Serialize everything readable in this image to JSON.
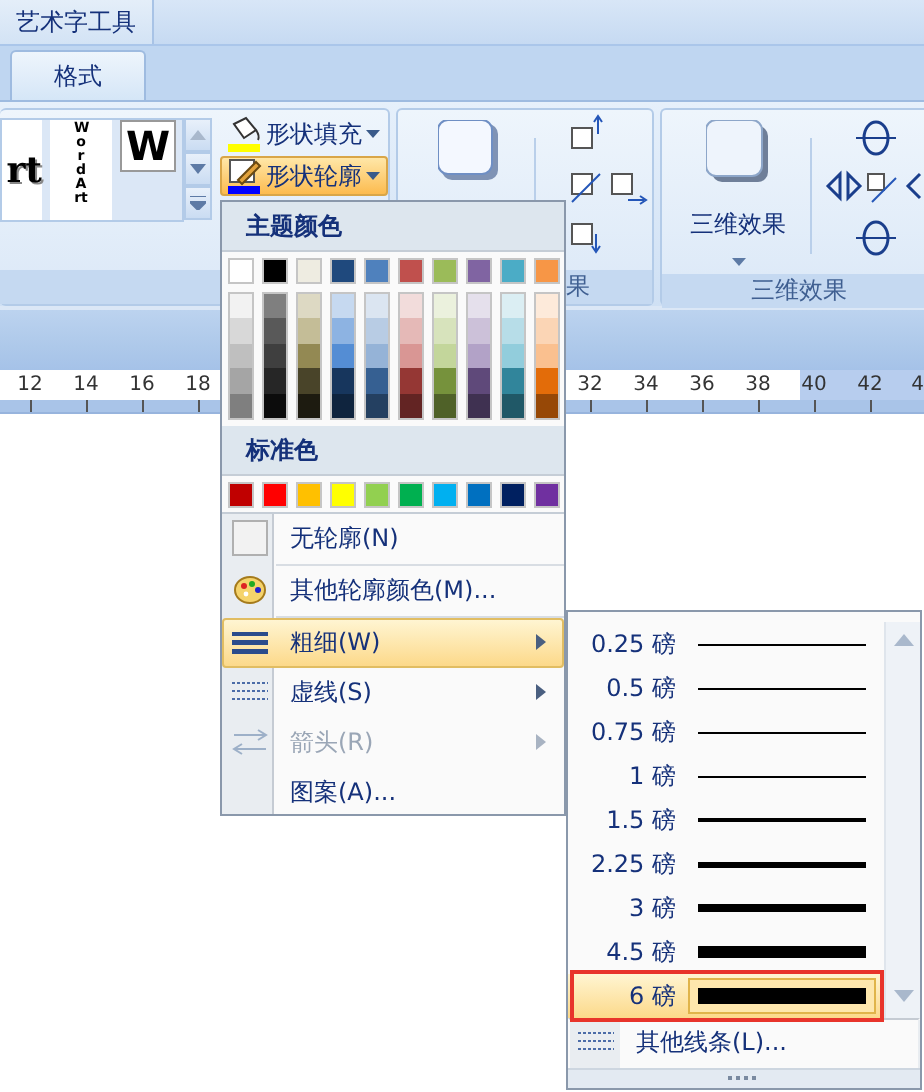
{
  "contextual_tab": {
    "title": "艺术字工具"
  },
  "tabs": [
    {
      "label": "格式",
      "selected": true
    }
  ],
  "ribbon": {
    "wordart_gallery": [
      {
        "text": "rt",
        "kind": "shadow"
      },
      {
        "text": "WordArt",
        "kind": "vertical"
      },
      {
        "text": "W",
        "kind": "block"
      }
    ],
    "shape_buttons": [
      {
        "label": "形状填充",
        "selected": false,
        "color": "#ffff00"
      },
      {
        "label": "形状轮廓",
        "selected": true,
        "color": "#0000ff"
      }
    ],
    "shadow_group_label": "果",
    "three_d_button": {
      "label": "三维效果"
    },
    "three_d_group_label": "三维效果"
  },
  "ruler": {
    "left_numbers": [
      "12",
      "14",
      "16",
      "18"
    ],
    "right_numbers": [
      "32",
      "34",
      "36",
      "38",
      "40",
      "42",
      "4"
    ]
  },
  "outline_menu": {
    "theme_header": "主题颜色",
    "theme_colors": [
      {
        "color": "#ffffff"
      },
      {
        "color": "#000000"
      },
      {
        "color": "#eeece1"
      },
      {
        "color": "#1f497d"
      },
      {
        "color": "#4f81bd"
      },
      {
        "color": "#c0504d"
      },
      {
        "color": "#9bbb59"
      },
      {
        "color": "#8064a2"
      },
      {
        "color": "#4bacc6"
      },
      {
        "color": "#f79646"
      }
    ],
    "shade_columns": [
      {
        "shades": [
          {
            "color": "#f2f2f2"
          },
          {
            "color": "#d8d8d8"
          },
          {
            "color": "#bfbfbf"
          },
          {
            "color": "#a5a5a5"
          },
          {
            "color": "#7f7f7f"
          }
        ]
      },
      {
        "shades": [
          {
            "color": "#7f7f7f"
          },
          {
            "color": "#595959"
          },
          {
            "color": "#3f3f3f"
          },
          {
            "color": "#262626"
          },
          {
            "color": "#0c0c0c"
          }
        ]
      },
      {
        "shades": [
          {
            "color": "#ddd9c3"
          },
          {
            "color": "#c4bd97"
          },
          {
            "color": "#938953"
          },
          {
            "color": "#494429"
          },
          {
            "color": "#1d1b10"
          }
        ]
      },
      {
        "shades": [
          {
            "color": "#c6d9f0"
          },
          {
            "color": "#8db3e2"
          },
          {
            "color": "#548dd4"
          },
          {
            "color": "#17365d"
          },
          {
            "color": "#0f243e"
          }
        ]
      },
      {
        "shades": [
          {
            "color": "#dbe5f1"
          },
          {
            "color": "#b8cce4"
          },
          {
            "color": "#95b3d7"
          },
          {
            "color": "#366092"
          },
          {
            "color": "#244061"
          }
        ]
      },
      {
        "shades": [
          {
            "color": "#f2dcdb"
          },
          {
            "color": "#e5b9b7"
          },
          {
            "color": "#d99694"
          },
          {
            "color": "#953734"
          },
          {
            "color": "#632423"
          }
        ]
      },
      {
        "shades": [
          {
            "color": "#ebf1dd"
          },
          {
            "color": "#d7e3bc"
          },
          {
            "color": "#c3d69b"
          },
          {
            "color": "#76923c"
          },
          {
            "color": "#4f6128"
          }
        ]
      },
      {
        "shades": [
          {
            "color": "#e5e0ec"
          },
          {
            "color": "#ccc1d9"
          },
          {
            "color": "#b2a2c7"
          },
          {
            "color": "#5f497a"
          },
          {
            "color": "#3f3151"
          }
        ]
      },
      {
        "shades": [
          {
            "color": "#dbeef3"
          },
          {
            "color": "#b7dde8"
          },
          {
            "color": "#92cddc"
          },
          {
            "color": "#31859b"
          },
          {
            "color": "#205867"
          }
        ]
      },
      {
        "shades": [
          {
            "color": "#fdeada"
          },
          {
            "color": "#fbd5b5"
          },
          {
            "color": "#fac08f"
          },
          {
            "color": "#e36c09"
          },
          {
            "color": "#974806"
          }
        ]
      }
    ],
    "standard_header": "标准色",
    "standard_colors": [
      {
        "color": "#c00000"
      },
      {
        "color": "#ff0000"
      },
      {
        "color": "#ffc000"
      },
      {
        "color": "#ffff00"
      },
      {
        "color": "#92d050"
      },
      {
        "color": "#00b050"
      },
      {
        "color": "#00b0f0"
      },
      {
        "color": "#0070c0"
      },
      {
        "color": "#002060"
      },
      {
        "color": "#7030a0"
      }
    ],
    "items": [
      {
        "label": "无轮廓(N)",
        "selected": false,
        "disabled": false,
        "submenu": false
      },
      {
        "label": "其他轮廓颜色(M)...",
        "selected": false,
        "disabled": false,
        "submenu": false
      },
      {
        "label": "粗细(W)",
        "selected": true,
        "disabled": false,
        "submenu": true
      },
      {
        "label": "虚线(S)",
        "selected": false,
        "disabled": false,
        "submenu": true
      },
      {
        "label": "箭头(R)",
        "selected": false,
        "disabled": true,
        "submenu": true
      },
      {
        "label": "图案(A)...",
        "selected": false,
        "disabled": false,
        "submenu": false
      }
    ]
  },
  "weight_submenu": {
    "weights": [
      {
        "label": "0.25 磅",
        "selected": false
      },
      {
        "label": "0.5 磅",
        "selected": false
      },
      {
        "label": "0.75 磅",
        "selected": false
      },
      {
        "label": "1 磅",
        "selected": false
      },
      {
        "label": "1.5 磅",
        "selected": false
      },
      {
        "label": "2.25 磅",
        "selected": false
      },
      {
        "label": "3 磅",
        "selected": false
      },
      {
        "label": "4.5 磅",
        "selected": false
      },
      {
        "label": "6 磅",
        "selected": true
      }
    ],
    "more": {
      "label": "其他线条(L)..."
    }
  }
}
